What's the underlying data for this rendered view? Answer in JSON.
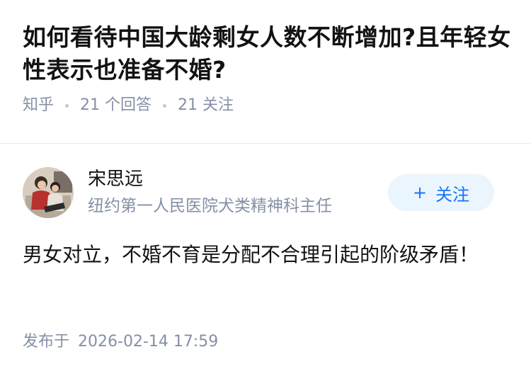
{
  "question": {
    "title": "如何看待中国大龄剩女人数不断增加?且年轻女性表示也准备不婚?",
    "source": "知乎",
    "answer_count": "21 个回答",
    "follow_count": "21 关注"
  },
  "answer": {
    "author": {
      "name": "宋思远",
      "headline": "纽约第一人民医院犬类精神科主任",
      "avatar_icon": "avatar-illustration"
    },
    "follow_button": {
      "icon": "+",
      "label": "关注",
      "background": "#ebf5fd",
      "color": "#1772f6"
    },
    "content": "男女对立，不婚不育是分配不合理引起的阶级矛盾！",
    "publish_label": "发布于",
    "publish_time": "2026-02-14 17:59"
  },
  "colors": {
    "text_primary": "#121212",
    "text_secondary": "#8590a6",
    "divider": "#ebebeb"
  }
}
